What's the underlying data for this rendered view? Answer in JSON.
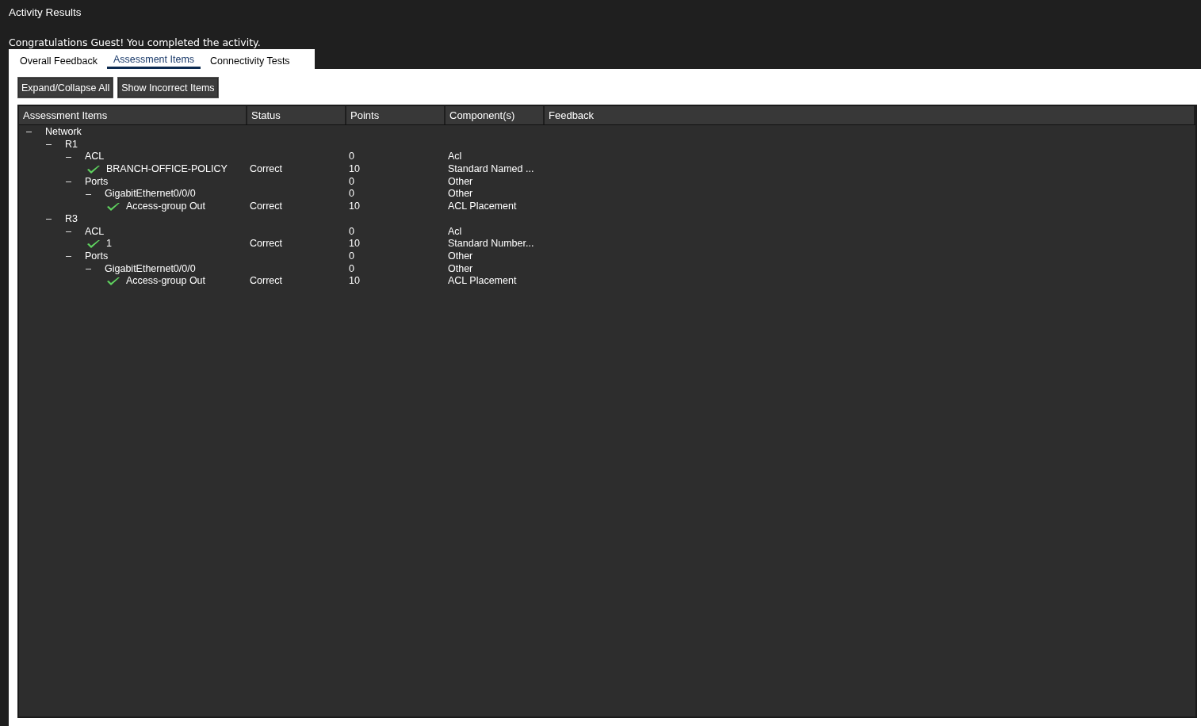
{
  "window": {
    "title": "Activity Results"
  },
  "message": "Congratulations Guest! You completed the activity.",
  "tabs": [
    {
      "label": "Overall Feedback",
      "selected": false
    },
    {
      "label": "Assessment Items",
      "selected": true
    },
    {
      "label": "Connectivity Tests",
      "selected": false
    }
  ],
  "buttons": [
    "Expand/Collapse All",
    "Show Incorrect Items"
  ],
  "table": {
    "columns": [
      "Assessment Items",
      "Status",
      "Points",
      "Component(s)",
      "Feedback"
    ],
    "rows": [
      {
        "kind": "group",
        "label": "Network",
        "expanded": true,
        "children": [
          {
            "kind": "group",
            "label": "R1",
            "expanded": true,
            "children": [
              {
                "kind": "group",
                "label": "ACL",
                "expanded": true,
                "points": "0",
                "component": "Acl",
                "children": [
                  {
                    "kind": "check",
                    "label": "BRANCH-OFFICE-POLICY",
                    "status": "Correct",
                    "points": "10",
                    "component": "Standard Named ..."
                  }
                ]
              },
              {
                "kind": "group",
                "label": "Ports",
                "expanded": true,
                "points": "0",
                "component": "Other",
                "children": [
                  {
                    "kind": "group",
                    "label": "GigabitEthernet0/0/0",
                    "expanded": true,
                    "points": "0",
                    "component": "Other",
                    "children": [
                      {
                        "kind": "check",
                        "label": "Access-group Out",
                        "status": "Correct",
                        "points": "10",
                        "component": "ACL Placement"
                      }
                    ]
                  }
                ]
              }
            ]
          },
          {
            "kind": "group",
            "label": "R3",
            "expanded": true,
            "children": [
              {
                "kind": "group",
                "label": "ACL",
                "expanded": true,
                "points": "0",
                "component": "Acl",
                "children": [
                  {
                    "kind": "check",
                    "label": "1",
                    "status": "Correct",
                    "points": "10",
                    "component": "Standard Number..."
                  }
                ]
              },
              {
                "kind": "group",
                "label": "Ports",
                "expanded": true,
                "points": "0",
                "component": "Other",
                "children": [
                  {
                    "kind": "group",
                    "label": "GigabitEthernet0/0/0",
                    "expanded": true,
                    "points": "0",
                    "component": "Other",
                    "children": [
                      {
                        "kind": "check",
                        "label": "Access-group Out",
                        "status": "Correct",
                        "points": "10",
                        "component": "ACL Placement"
                      }
                    ]
                  }
                ]
              }
            ]
          }
        ]
      }
    ]
  }
}
